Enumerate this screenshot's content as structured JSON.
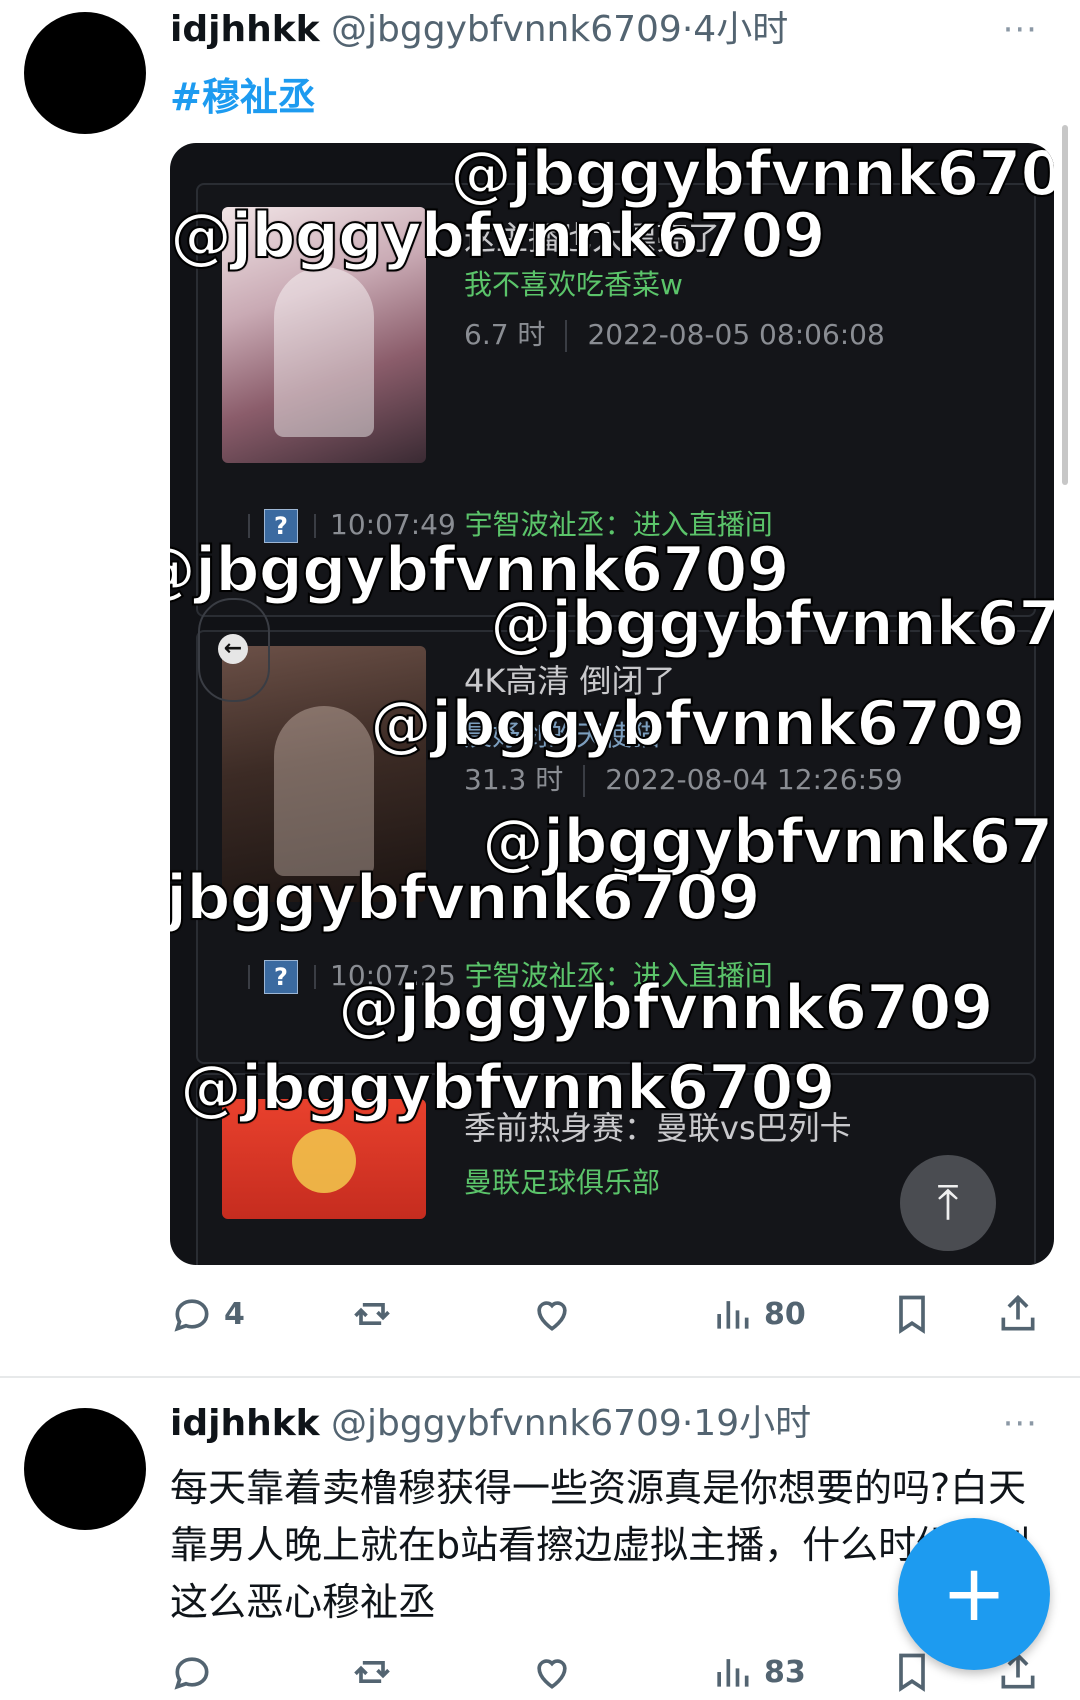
{
  "post1": {
    "display_name": "idjhhkk",
    "handle": "@jbggybfvnnk6709",
    "separator": "·",
    "time": "4小时",
    "more": "···",
    "hashtag": "#穆祉丞",
    "media": {
      "cards": [
        {
          "title": "这主播也太漂亮了",
          "subtitle": "我不喜欢吃香菜w",
          "duration": "6.7 时",
          "datetime": "2022-08-05 08:06:08",
          "foot_icon": "?",
          "foot_time": "10:07:49",
          "foot_user": "宇智波祉丞",
          "foot_colon": "：",
          "foot_action": "进入直播间"
        },
        {
          "title": "4K高清 倒闭了",
          "subtitle": "晨妤剑的天使猫",
          "duration": "31.3 时",
          "datetime": "2022-08-04 12:26:59",
          "foot_icon": "?",
          "foot_time": "10:07:25",
          "foot_user": "宇智波祉丞",
          "foot_colon": "：",
          "foot_action": "进入直播间"
        },
        {
          "title": "季前热身赛：曼联vs巴列卡",
          "subtitle": "曼联足球俱乐部"
        }
      ],
      "watermarks": [
        "@jbggybfvnnk670",
        "@jbggybfvnnk6709",
        "@jbggybfvnnk6709",
        "@jbggybfvnnk67",
        "@jbggybfvnnk6709",
        "@jbggybfvnnk67",
        "jbggybfvnnk6709",
        "@jbggybfvnnk6709",
        "@jbggybfvnnk6709"
      ],
      "back_icon": "←",
      "scroll_top_icon": "⤒"
    },
    "actions": {
      "replies": "4",
      "reposts": "",
      "likes": "",
      "views": "80"
    }
  },
  "post2": {
    "display_name": "idjhhkk",
    "handle": "@jbggybfvnnk6709",
    "separator": "·",
    "time": "19小时",
    "more": "···",
    "text": "每天靠着卖橹穆获得一些资源真是你想要的吗?白天靠男人晚上就在b站看擦边虚拟主播，什么时候能别这么恶心穆祉丞",
    "actions": {
      "replies": "",
      "reposts": "",
      "likes": "",
      "views": "83"
    }
  },
  "fab_icon": "+",
  "colors": {
    "accent": "#1d9bf0",
    "text": "#0f1419",
    "muted": "#536471",
    "green": "#5bc46a"
  }
}
